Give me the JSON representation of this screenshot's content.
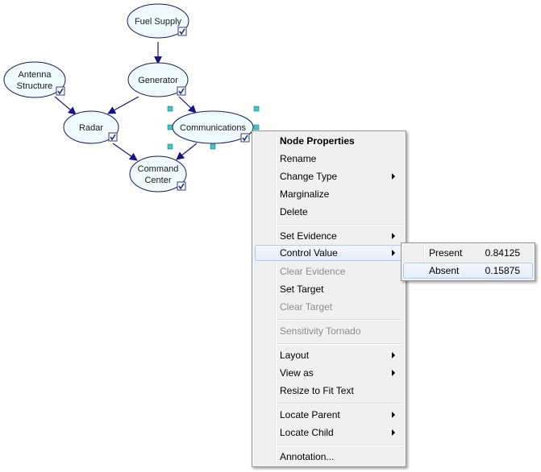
{
  "graph": {
    "nodes": [
      {
        "id": "fuel_supply",
        "lines": [
          "Fuel Supply"
        ]
      },
      {
        "id": "antenna_structure",
        "lines": [
          "Antenna",
          "Structure"
        ]
      },
      {
        "id": "generator",
        "lines": [
          "Generator"
        ]
      },
      {
        "id": "radar",
        "lines": [
          "Radar"
        ]
      },
      {
        "id": "communications",
        "lines": [
          "Communications"
        ]
      },
      {
        "id": "command_center",
        "lines": [
          "Command",
          "Center"
        ]
      }
    ],
    "colors": {
      "node_fill": "#eefafb",
      "node_stroke": "#1a1a5e",
      "edge": "#14148c",
      "handle": "#3cc9c5"
    }
  },
  "menu": {
    "items": {
      "node_properties": "Node Properties",
      "rename": "Rename",
      "change_type": "Change Type",
      "marginalize": "Marginalize",
      "delete": "Delete",
      "set_evidence": "Set Evidence",
      "control_value": "Control Value",
      "clear_evidence": "Clear Evidence",
      "set_target": "Set Target",
      "clear_target": "Clear Target",
      "sensitivity_tornado": "Sensitivity Tornado",
      "layout": "Layout",
      "view_as": "View as",
      "resize_to_fit_text": "Resize to Fit Text",
      "locate_parent": "Locate Parent",
      "locate_child": "Locate Child",
      "annotation": "Annotation..."
    }
  },
  "submenu": {
    "items": [
      {
        "state": "Present",
        "value": "0.84125"
      },
      {
        "state": "Absent",
        "value": "0.15875"
      }
    ]
  }
}
